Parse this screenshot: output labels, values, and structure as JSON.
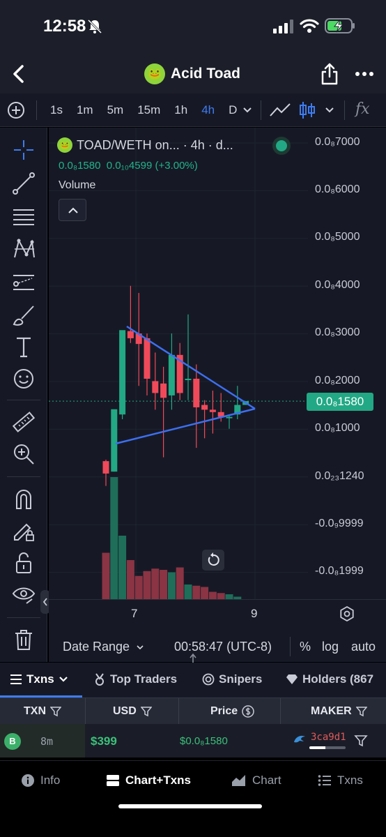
{
  "status": {
    "time": "12:58"
  },
  "header": {
    "title": "Acid Toad",
    "logo_emoji": "🐸"
  },
  "toolbar": {
    "intervals": [
      "1s",
      "1m",
      "5m",
      "15m",
      "1h",
      "4h",
      "D"
    ],
    "active_interval": "4h",
    "fx_label": "fx"
  },
  "chart": {
    "legend_pair": "TOAD/WETH on... · 4h · d...",
    "legend_price": "0.0₈1580",
    "legend_change": "0.0₁₀4599 (+3.00%)",
    "volume_label": "Volume",
    "current_price": "0.0₈1580",
    "price_labels": [
      "0.0₈7000",
      "0.0₈6000",
      "0.0₈5000",
      "0.0₈4000",
      "0.0₈3000",
      "0.0₈2000",
      "0.0₈1000",
      "0.0₂₃1240",
      "-0.0₉9999",
      "-0.0₈1999"
    ],
    "time_labels": [
      "7",
      "9"
    ]
  },
  "chart_data": {
    "type": "candlestick",
    "series": [
      {
        "name": "TOAD/WETH",
        "candles": [
          {
            "o": 0.32,
            "h": 0.35,
            "l": -0.2,
            "c": 0.06
          },
          {
            "o": 0.1,
            "h": 0.45,
            "l": 0.1,
            "c": 1.41
          },
          {
            "o": 1.3,
            "h": 2.7,
            "l": 1.2,
            "c": 3.07
          },
          {
            "o": 3.05,
            "h": 4.0,
            "l": 2.8,
            "c": 2.9
          },
          {
            "o": 3.0,
            "h": 3.85,
            "l": 1.9,
            "c": 2.78
          },
          {
            "o": 2.9,
            "h": 3.0,
            "l": 1.7,
            "c": 2.05
          },
          {
            "o": 2.0,
            "h": 2.6,
            "l": 1.4,
            "c": 1.75
          },
          {
            "o": 1.95,
            "h": 2.3,
            "l": 0.4,
            "c": 1.65
          },
          {
            "o": 1.7,
            "h": 3.0,
            "l": 1.4,
            "c": 2.55
          },
          {
            "o": 2.55,
            "h": 2.8,
            "l": 1.6,
            "c": 1.75
          },
          {
            "o": 2.05,
            "h": 3.4,
            "l": 1.6,
            "c": 2.05
          },
          {
            "o": 2.05,
            "h": 2.35,
            "l": 0.6,
            "c": 1.45
          },
          {
            "o": 1.5,
            "h": 1.6,
            "l": 0.8,
            "c": 1.4
          },
          {
            "o": 1.4,
            "h": 1.8,
            "l": 0.9,
            "c": 1.35
          },
          {
            "o": 1.35,
            "h": 1.75,
            "l": 1.15,
            "c": 1.25
          },
          {
            "o": 1.25,
            "h": 1.3,
            "l": 1.0,
            "c": 1.25
          },
          {
            "o": 1.3,
            "h": 1.9,
            "l": 1.2,
            "c": 1.5
          },
          {
            "o": 1.5,
            "h": 1.55,
            "l": 1.55,
            "c": 1.58
          }
        ],
        "volume": [
          0.38,
          1.0,
          0.52,
          0.32,
          0.19,
          0.23,
          0.25,
          0.24,
          0.22,
          0.26,
          0.12,
          0.11,
          0.1,
          0.06,
          0.05,
          0.04,
          0.02
        ]
      }
    ]
  },
  "bottombar": {
    "date_range": "Date Range",
    "time": "00:58:47 (UTC-8)",
    "pct": "%",
    "log": "log",
    "auto": "auto"
  },
  "tabs": [
    {
      "label": "Txns",
      "active": true
    },
    {
      "label": "Top Traders"
    },
    {
      "label": "Snipers"
    },
    {
      "label": "Holders (867"
    }
  ],
  "table": {
    "headers": [
      "TXN",
      "USD",
      "Price",
      "MAKER"
    ],
    "rows": [
      {
        "type": "B",
        "age": "8m",
        "usd": "$399",
        "price": "$0.0₈1580",
        "maker": "3ca9d1",
        "maker_fill": 0.45
      }
    ]
  },
  "nav": [
    {
      "label": "Info"
    },
    {
      "label": "Chart+Txns",
      "active": true
    },
    {
      "label": "Chart"
    },
    {
      "label": "Txns"
    }
  ],
  "colors": {
    "up": "#22a884",
    "down": "#f04a5a",
    "accent": "#3f7cf0",
    "trend": "#3d6ff2"
  }
}
